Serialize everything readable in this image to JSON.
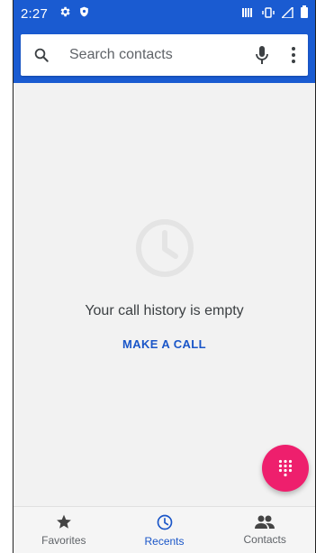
{
  "status_bar": {
    "time": "2:27",
    "left_icons": [
      "gear-icon",
      "shield-icon"
    ],
    "right_icons": [
      "cast-icon",
      "vibrate-icon",
      "signal-icon",
      "battery-icon"
    ]
  },
  "search": {
    "placeholder": "Search contacts",
    "icons": [
      "search-icon",
      "mic-icon",
      "more-vert-icon"
    ]
  },
  "empty_state": {
    "icon": "clock-icon",
    "message": "Your call history is empty",
    "action_label": "MAKE A CALL"
  },
  "fab": {
    "icon": "dialpad-icon",
    "color": "#ee1f6d"
  },
  "bottom_nav": {
    "items": [
      {
        "label": "Favorites",
        "icon": "star-icon",
        "active": false
      },
      {
        "label": "Recents",
        "icon": "clock-icon",
        "active": true
      },
      {
        "label": "Contacts",
        "icon": "people-icon",
        "active": false
      }
    ]
  },
  "colors": {
    "primary": "#1a5bd1",
    "accent": "#ee1f6d",
    "active_text": "#1a56c8"
  }
}
